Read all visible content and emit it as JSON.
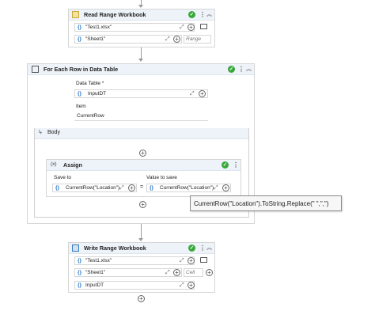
{
  "read_range": {
    "title": "Read Range Workbook",
    "workbook_path": "\"Test1.xlsx\"",
    "sheet_name": "\"Sheet1\"",
    "range_placeholder": "Range"
  },
  "for_each": {
    "title": "For Each Row in Data Table",
    "datatable_label": "Data Table *",
    "datatable_value": "InputDT",
    "item_label": "Item",
    "item_value": "CurrentRow",
    "body_title": "Body"
  },
  "assign": {
    "title": "Assign",
    "save_to_label": "Save to",
    "value_to_save_label": "Value to save",
    "save_to_value": "CurrentRow(\"Location\")",
    "equals": "=",
    "value_value": "CurrentRow(\"Location\")"
  },
  "tooltip": {
    "text": "CurrentRow(\"Location\").ToString.Replace(\" \",\",\")"
  },
  "write_range": {
    "title": "Write Range Workbook",
    "workbook_path": "\"Test1.xlsx\"",
    "sheet_name": "\"Sheet1\"",
    "cell_placeholder": "Cell",
    "datatable_value": "InputDT"
  },
  "icons": {
    "brace": "{}",
    "expand": "⤢",
    "plus": "+",
    "check": "✓",
    "more": "⋮",
    "collapse": "︽",
    "assign": "(x)"
  },
  "colors": {
    "header_bg": "#eef3f9",
    "success": "#38a83a",
    "brace": "#1f6fc2"
  }
}
